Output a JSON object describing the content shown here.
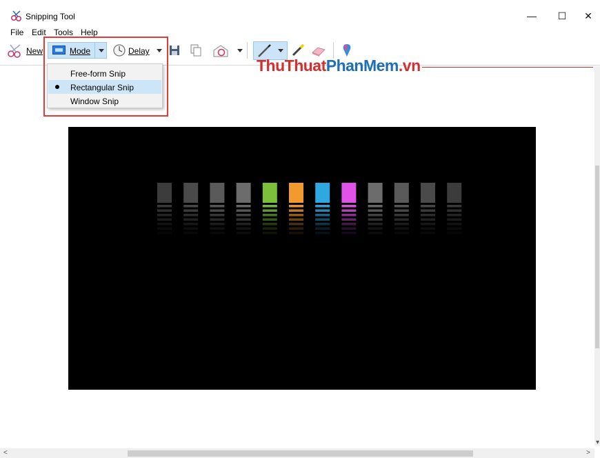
{
  "window": {
    "title": "Snipping Tool",
    "min_glyph": "—",
    "max_glyph": "☐",
    "close_glyph": "✕"
  },
  "menu": [
    "File",
    "Edit",
    "Tools",
    "Help"
  ],
  "toolbar": {
    "new_label": "New",
    "mode_label": "Mode",
    "delay_label": "Delay"
  },
  "mode_menu": {
    "options": [
      "Free-form Snip",
      "Rectangular Snip",
      "Window Snip"
    ],
    "selected": "Rectangular Snip"
  },
  "watermark": {
    "part1": "ThuThuat",
    "part2": "PhanMem",
    "part3": ".vn",
    "colors": {
      "part1": "#d32f2f",
      "part2": "#1e6fb5",
      "part3": "#d32f2f"
    }
  },
  "image": {
    "background": "#000000",
    "bar_colors": [
      "#3c3c3c",
      "#4a4a4a",
      "#5a5a5a",
      "#6c6c6c",
      "#7bbf3a",
      "#f29a2e",
      "#2ea9e0",
      "#e052e8",
      "#6c6c6c",
      "#5a5a5a",
      "#4a4a4a",
      "#3c3c3c"
    ]
  },
  "scroll": {
    "left": "<",
    "right": ">"
  }
}
